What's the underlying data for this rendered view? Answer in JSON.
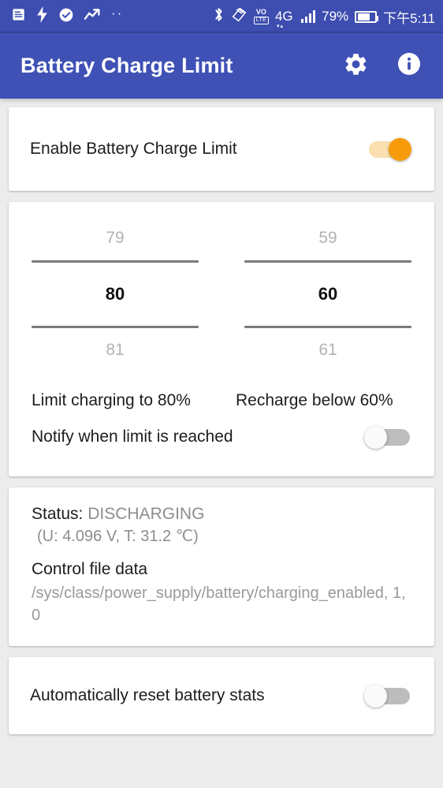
{
  "status_bar": {
    "icons_left": [
      "note-icon",
      "lightning-bolt-icon",
      "check-circle-icon",
      "trending-up-icon",
      "more-dots-icon"
    ],
    "more_dots": "··",
    "bluetooth_icon": "bluetooth-icon",
    "screenshot_icon": "screen-cast-icon",
    "volte_top": "VO",
    "volte_bottom": "LTE",
    "network": "4G",
    "signal_icon": "signal-bars-icon",
    "battery_percent": "79%",
    "battery_icon": "battery-icon",
    "clock": "下午5:11"
  },
  "app_bar": {
    "title": "Battery Charge Limit",
    "settings_icon": "gear-icon",
    "info_icon": "info-icon"
  },
  "enable_card": {
    "label": "Enable Battery Charge Limit",
    "toggle_state": "on"
  },
  "limit_card": {
    "limit_picker": {
      "previous": "79",
      "value": "80",
      "next": "81"
    },
    "recharge_picker": {
      "previous": "59",
      "value": "60",
      "next": "61"
    },
    "limit_label": "Limit charging to 80%",
    "recharge_label": "Recharge below 60%",
    "notify_label": "Notify when limit is reached",
    "notify_toggle_state": "off"
  },
  "status_card": {
    "status_key": "Status:",
    "status_value": "DISCHARGING",
    "voltage_temp": "(U: 4.096 V, T: 31.2 ℃)",
    "control_file_heading": "Control file data",
    "control_file_path": "/sys/class/power_supply/battery/charging_enabled, 1, 0"
  },
  "auto_reset_card": {
    "label": "Automatically reset battery stats",
    "toggle_state": "off"
  },
  "colors": {
    "status_bar": "#3d4db0",
    "app_bar": "#3f51b5",
    "page_bg": "#ececec",
    "card_bg": "#ffffff",
    "toggle_on_thumb": "#f79b0d",
    "toggle_on_track": "#fbdfb0",
    "toggle_off_thumb": "#fafafa",
    "toggle_off_track": "#bdbdbd",
    "picker_line": "#7b7b7b",
    "muted_text": "#8d8d8d"
  }
}
